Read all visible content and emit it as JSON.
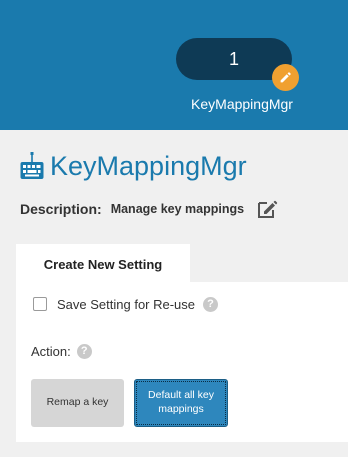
{
  "header": {
    "profile_number": "1",
    "profile_name": "KeyMappingMgr",
    "colors": {
      "bg": "#1a7aad",
      "pill": "#0e3a55",
      "badge": "#f0a030"
    }
  },
  "title": {
    "icon": "keyboard-icon",
    "text": "KeyMappingMgr"
  },
  "description": {
    "label": "Description:",
    "text": "Manage key mappings",
    "edit_icon": "edit-icon"
  },
  "tabs": [
    {
      "label": "Create New Setting",
      "active": true
    }
  ],
  "form": {
    "save_label": "Save Setting for Re-use",
    "save_checked": false,
    "action_label": "Action:",
    "help_icon": "help-icon"
  },
  "buttons": {
    "remap": "Remap a key",
    "default_all": "Default all key mappings"
  }
}
